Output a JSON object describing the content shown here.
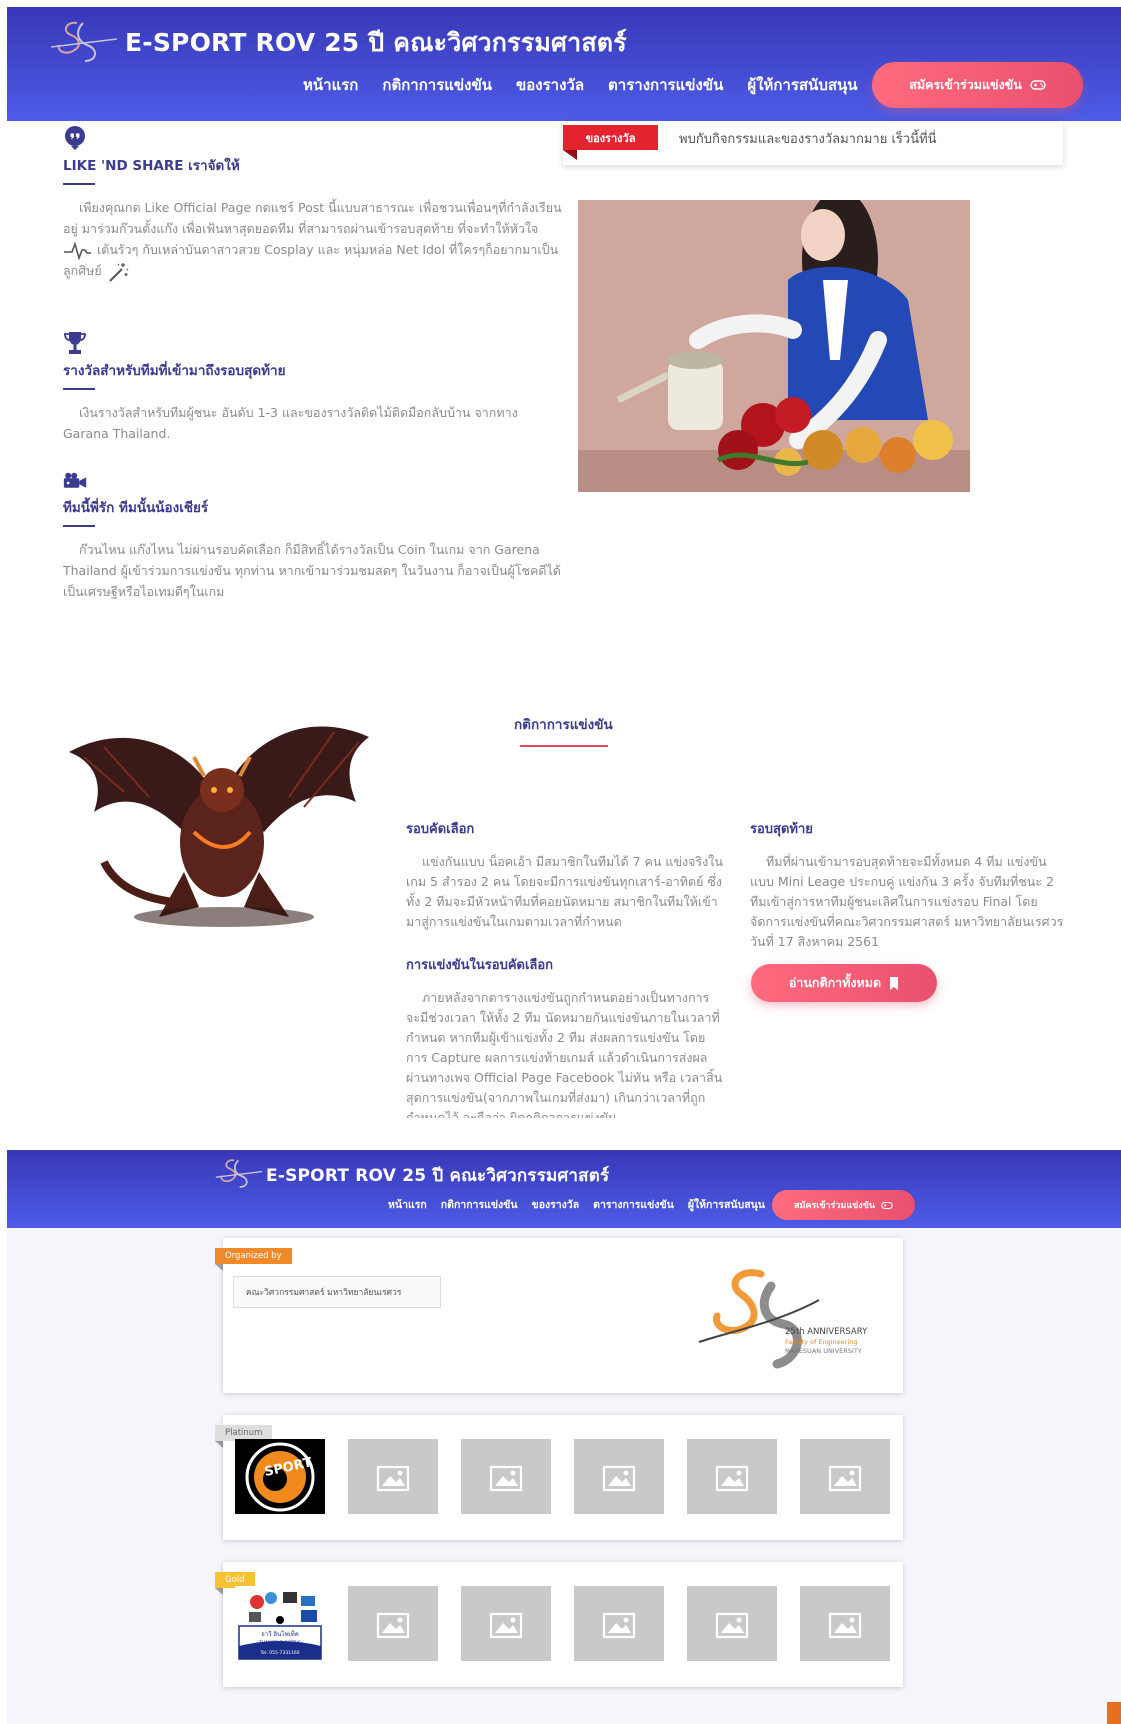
{
  "header": {
    "title": "E-SPORT ROV 25 ปี คณะวิศวกรรมศาสตร์",
    "nav": [
      "หน้าแรก",
      "กติกาการแข่งขัน",
      "ของรางวัล",
      "ตารางการแข่งขัน",
      "ผู้ให้การสนับสนุน"
    ],
    "cta": "สมัครเข้าร่วมแข่งขัน"
  },
  "features": [
    {
      "icon": "quote-bubble-icon",
      "title": "LIKE 'ND SHARE เราจัดให้",
      "text": "เพียงคุณกด Like Official Page กดแชร์ Post นี้แบบสาธารณะ เพื่อชวนเพื่อนๆที่กำลังเรียนอยู่ มาร่วมก๊วนตั้งแก๊ง เพื่อเฟ้นหาสุดยอดทีม ที่สามารถผ่านเข้ารอบสุดท้าย ที่จะทำให้หัวใจ",
      "text2": "เต้นรัวๆ กับเหล่าบันดาสาวสวย Cosplay และ หนุ่มหล่อ Net Idol ที่ใครๆก็อยากมาเป็นลูกศิษย์"
    },
    {
      "icon": "trophy-icon",
      "title": "รางวัลสำหรับทีมที่เข้ามาถึงรอบสุดท้าย",
      "text": "เงินรางวัลสำหรับทีมผู้ชนะ อันดับ 1-3 และของรางวัลติดไม้ติดมือกลับบ้าน จากทาง Garana Thailand."
    },
    {
      "icon": "video-camera-icon",
      "title": "ทีมนี้พี่รัก ทีมนั้นน้องเชียร์",
      "text": "ก๊วนไหน แก๊งไหน ไม่ผ่านรอบคัดเลือก ก็มีสิทธิ์ได้รางวัลเป็น Coin ในเกม จาก Garena Thailand ผู้เข้าร่วมการแข่งขัน ทุกท่าน หากเข้ามาร่วมชมสดๆ ในวันงาน ก็อาจเป็นผู้โชคดีได้เป็นเศรษฐีหรือไอเทมดีๆในเกม"
    }
  ],
  "ticker": {
    "tag": "ของรางวัล",
    "text": "พบกับกิจกรรมและของรางวัลมากมาย เร็วนี้ที่นี่"
  },
  "rules": {
    "title": "กติกาการแข่งขัน",
    "qualifier_title": "รอบคัดเลือก",
    "qualifier_text": "แข่งกันแบบ น็อคเอ้า มีสมาชิกในทีมได้ 7 คน แข่งจริงในเกม 5 สำรอง 2 คน โดยจะมีการแข่งขันทุกเสาร์-อาทิตย์ ซึ่งทั้ง 2 ทีมจะมีหัวหน้าทีมที่คอยนัดหมาย สมาชิกในทีมให้เข้ามาสู่การแข่งขันในเกมตามเวลาที่กำหนด",
    "match_title": "การแข่งขันในรอบคัดเลือก",
    "match_text": "ภายหลังจากตารางแข่งขันถูกกำหนดอย่างเป็นทางการ จะมีช่วงเวลา ให้ทั้ง 2 ทีม นัดหมายกันแข่งขันภายในเวลาที่กำหนด หากทีมผู้เข้าแข่งทั้ง 2 ทีม ส่งผลการแข่งขัน โดยการ Capture ผลการแข่งท้ายเกมส์ แล้วดำเนินการส่งผลผ่านทางเพจ Official Page Facebook ไม่ทัน หรือ เวลาสิ้นสุดการแข่งขัน(จากภาพในเกมที่ส่งมา) เกินกว่าเวลาที่ถูกกำหนดไว้ จะถือว่า ผิดกติกาการแข่งขัน",
    "final_title": "รอบสุดท้าย",
    "final_text": "ทีมที่ผ่านเข้ามารอบสุดท้ายจะมีทั้งหมด 4 ทีม แข่งขันแบบ Mini Leage ประกบคู่ แข่งกัน 3 ครั้ง จับทีมที่ชนะ 2 ทีมเข้าสู่การหาทีมผู้ชนะเลิศในการแข่งรอบ Final โดยจัดการแข่งขันที่คณะวิศวกรรมศาสตร์ มหาวิทยาลัยนเรศวร วันที่ 17 สิงหาคม 2561",
    "read_all": "อ่านกติกาทั้งหมด"
  },
  "sponsors": {
    "organized_label": "Organized by",
    "organizer": "คณะวิศวกรรมศาสตร์ มหาวิทยาลัยนเรศวร",
    "anniversary": [
      "25th ANNIVERSARY",
      "Faculty of Engineering",
      "NARESUAN UNIVERSITY"
    ],
    "platinum_label": "Platinum",
    "platinum_logo_text": "SPORT",
    "gold_label": "Gold",
    "gold_logo_text": "ธาวี อินโฟเท็ค",
    "gold_logo_sub": "THAWEE ELECTRIC",
    "gold_logo_tel": "Tel. 055-7331160"
  },
  "colors": {
    "header_top": "#3838b8",
    "header_bottom": "#4d5ce6",
    "accent_pink": "#e9506e",
    "heading_navy": "#3b3b8f",
    "ticker_red": "#e3242f",
    "organized_orange": "#f0892a",
    "gold": "#f6c233"
  }
}
